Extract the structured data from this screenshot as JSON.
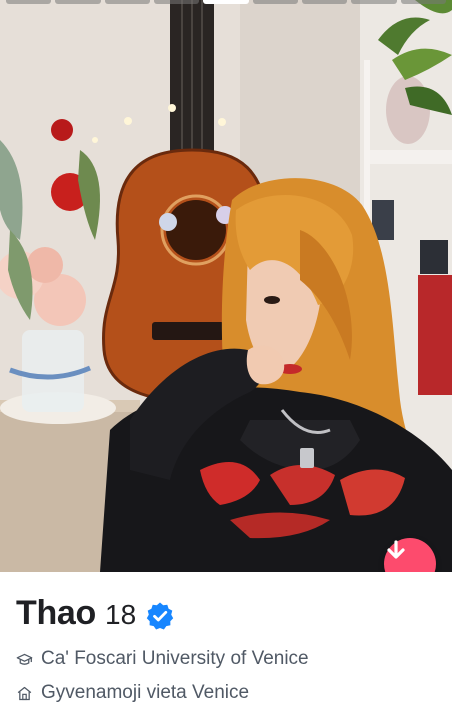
{
  "profile": {
    "name": "Thao",
    "age": "18",
    "verified": true,
    "school": "Ca' Foscari University of Venice",
    "lives_in": "Gyvenamoji vieta Venice"
  },
  "photo": {
    "progress_segments": 9,
    "active_segment": 5
  },
  "icons": {
    "verified": "verified-badge-icon",
    "school": "graduation-cap-icon",
    "home": "home-icon",
    "down": "arrow-down-icon"
  },
  "colors": {
    "accent": "#fd4b6d",
    "verified": "#1786ff",
    "name_text": "#1f2024",
    "detail_text": "#505965"
  }
}
